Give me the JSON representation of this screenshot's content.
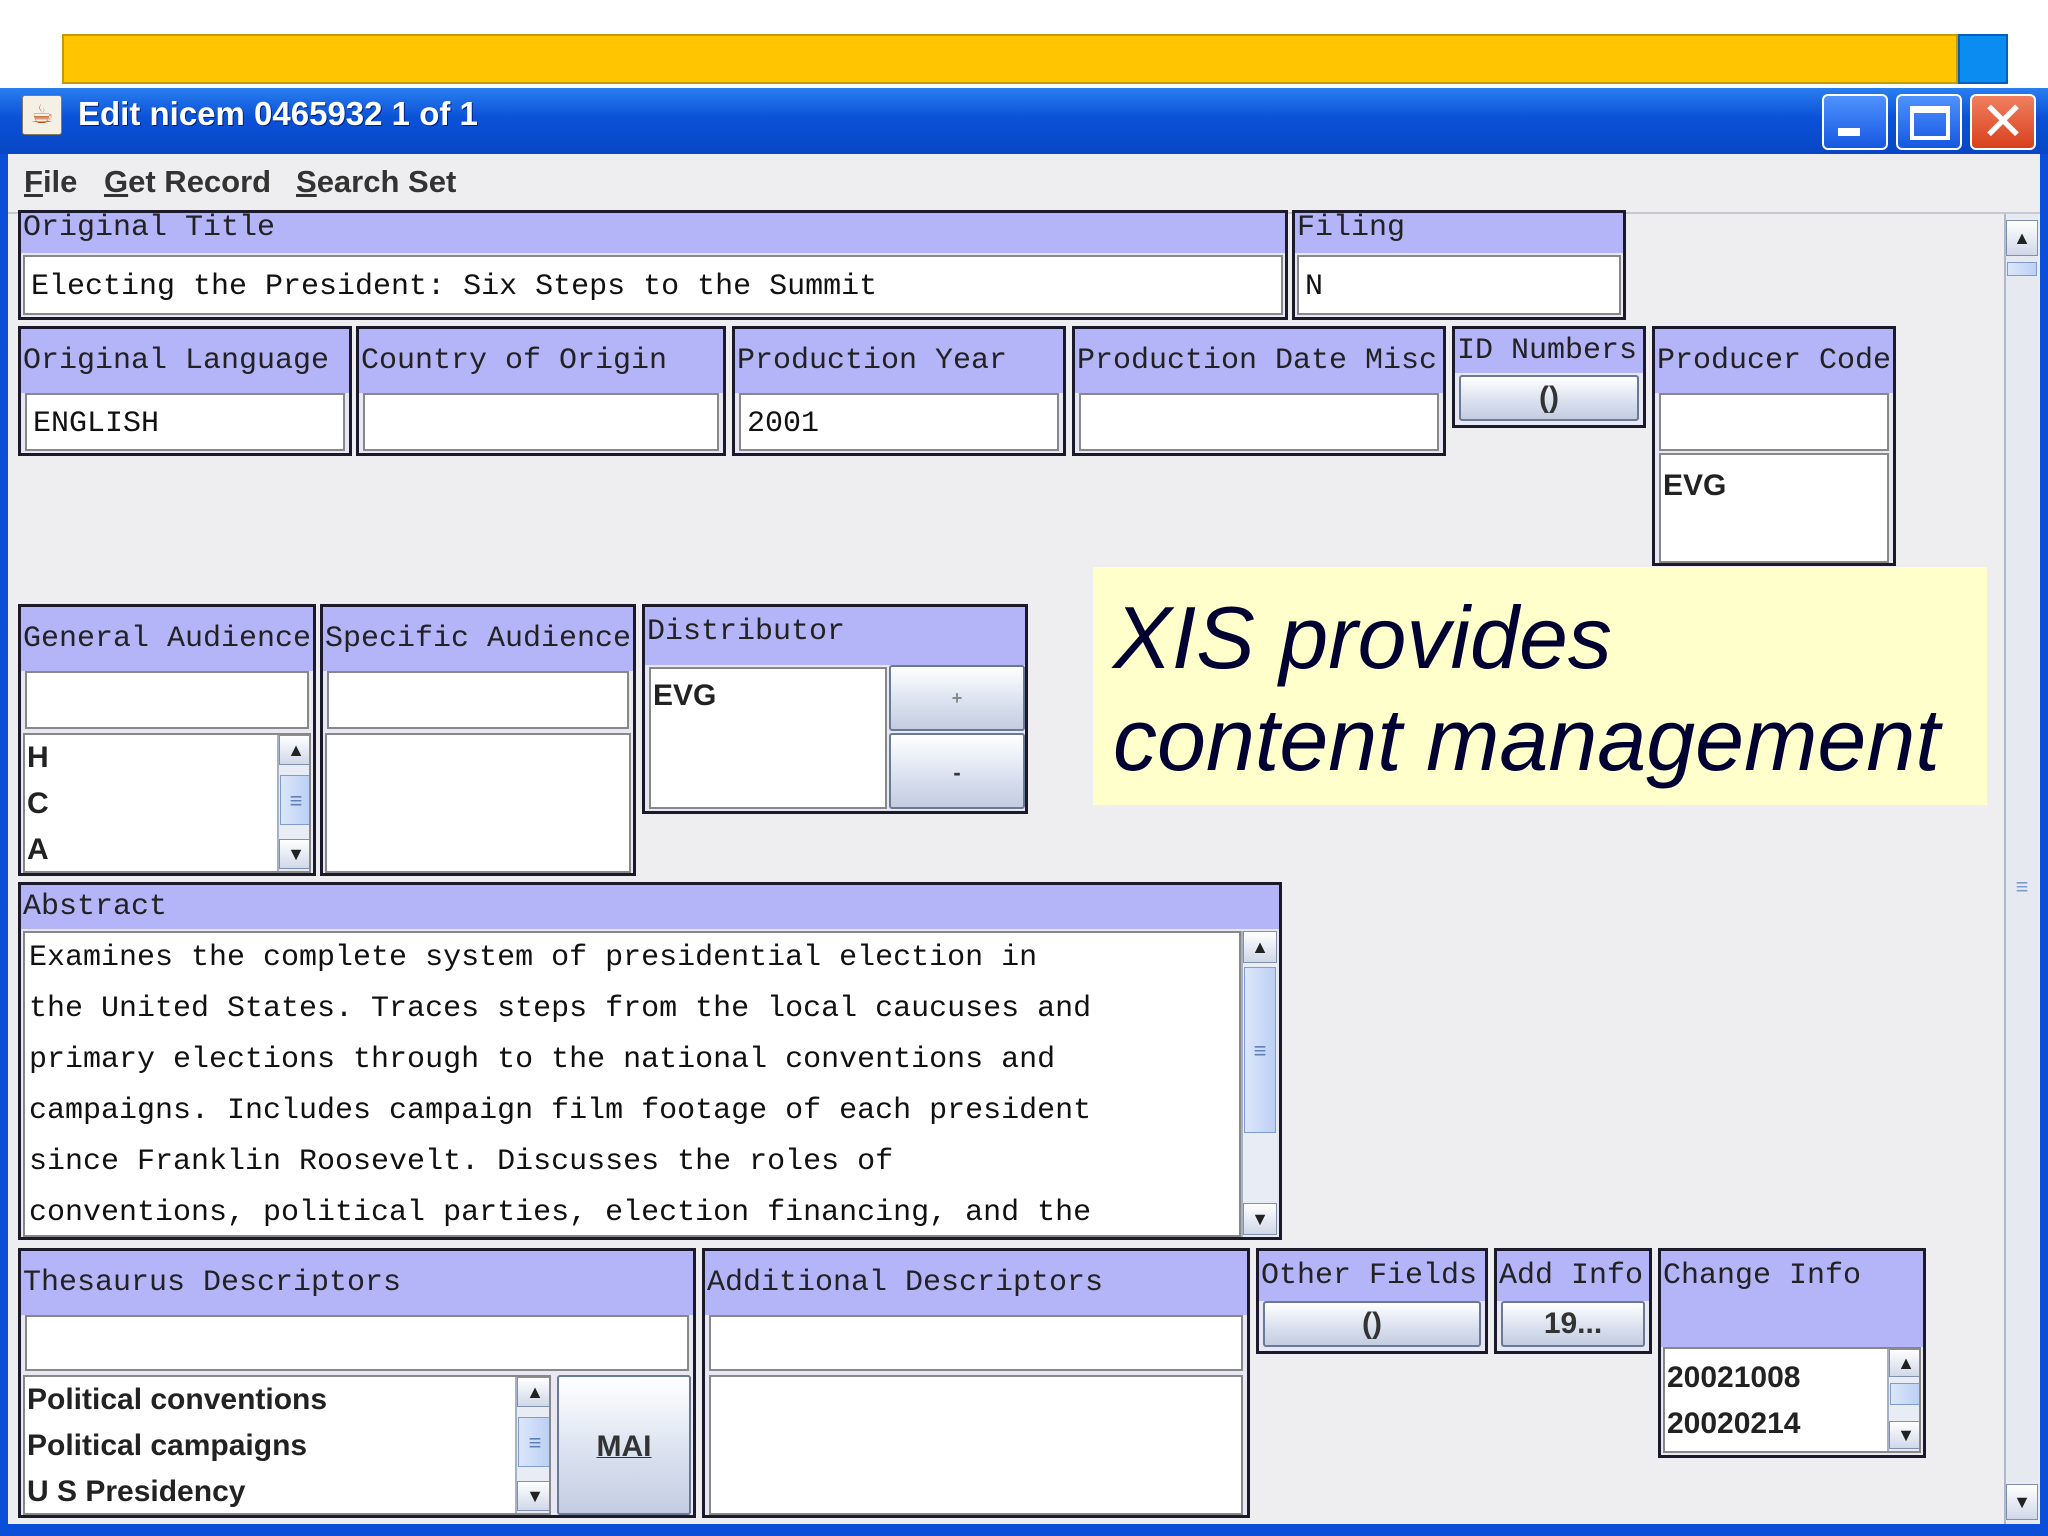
{
  "window": {
    "title": "Edit nicem 0465932 1 of 1",
    "controls": {
      "minimize_icon": "minimize-icon",
      "maximize_icon": "maximize-icon",
      "close_icon": "close-icon",
      "close_glyph": "✕"
    }
  },
  "menu": {
    "file": "File",
    "get_record": "Get Record",
    "search_set": "Search Set"
  },
  "fields": {
    "original_title": {
      "label": "Original Title",
      "value": "Electing the President: Six Steps to the Summit"
    },
    "filing": {
      "label": "Filing",
      "value": "N"
    },
    "original_language": {
      "label": "Original Language",
      "value": "ENGLISH"
    },
    "country_of_origin": {
      "label": "Country of Origin",
      "value": ""
    },
    "production_year": {
      "label": "Production Year",
      "value": "2001"
    },
    "production_date_misc": {
      "label": "Production Date Misc",
      "value": ""
    },
    "id_numbers": {
      "label": "ID Numbers",
      "button": "()"
    },
    "producer_code": {
      "label": "Producer Code",
      "value": "",
      "list": [
        "EVG"
      ]
    },
    "general_audience": {
      "label": "General Audience",
      "value": "",
      "list": [
        "H",
        "C",
        "A"
      ]
    },
    "specific_audience": {
      "label": "Specific Audience",
      "value": ""
    },
    "distributor": {
      "label": "Distributor",
      "list": [
        "EVG"
      ],
      "add_button": "+",
      "remove_button": "-"
    },
    "abstract": {
      "label": "Abstract",
      "lines": [
        "Examines the complete system of presidential election in",
        "the United States. Traces steps from the local caucuses and",
        "primary elections through to the national conventions and",
        "campaigns. Includes campaign film footage of each president",
        "since Franklin Roosevelt. Discusses the roles of",
        "conventions, political parties, election financing, and the"
      ]
    },
    "thesaurus_descriptors": {
      "label": "Thesaurus Descriptors",
      "value": "",
      "list": [
        "Political conventions",
        "Political campaigns",
        "U S Presidency"
      ],
      "button": "MAI"
    },
    "additional_descriptors": {
      "label": "Additional Descriptors",
      "value": ""
    },
    "other_fields": {
      "label": "Other Fields",
      "button": "()"
    },
    "add_info": {
      "label": "Add Info",
      "button": "19..."
    },
    "change_info": {
      "label": "Change Info",
      "list": [
        "20021008",
        "20020214"
      ]
    }
  },
  "callout": {
    "line1": "XIS provides",
    "line2": "content management"
  },
  "scroll_arrows": {
    "up": "▲",
    "down": "▼",
    "grip": "≡"
  },
  "colors": {
    "title_bar": "#0a52d8",
    "field_header": "#b4b4f8",
    "slide_bar": "#ffc600",
    "slide_square": "#0a8cf0",
    "callout_bg": "#ffffcc"
  }
}
